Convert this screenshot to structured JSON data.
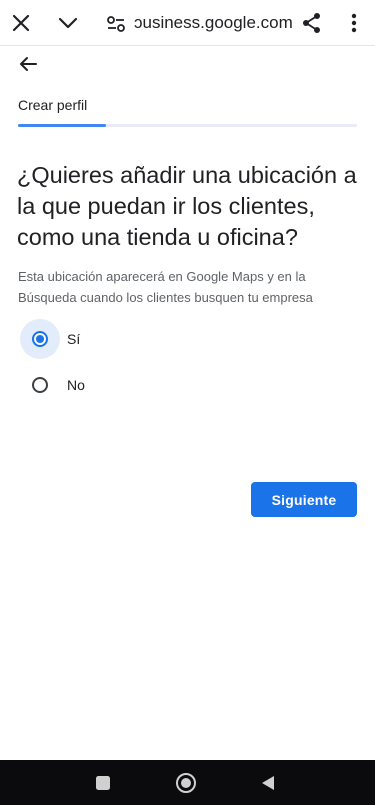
{
  "browser": {
    "url": "business.google.com",
    "url_display": "ɔusiness.google.com",
    "icons": {
      "close": "close-icon",
      "menu_down": "chevron-down-icon",
      "site_settings": "site-settings-icon",
      "share": "share-icon",
      "more": "more-vert-icon"
    }
  },
  "header": {
    "back_icon": "arrow-back-icon",
    "step_title": "Crear perfil",
    "progress_fraction": 0.26
  },
  "main": {
    "question": "¿Quieres añadir una ubicación a la que puedan ir los clientes, como una tienda u oficina?",
    "subtitle": "Esta ubicación aparecerá en Google Maps y en la Búsqueda cuando los clientes busquen tu empresa",
    "options": [
      {
        "label": "Sí",
        "selected": true
      },
      {
        "label": "No",
        "selected": false
      }
    ],
    "next_label": "Siguiente"
  },
  "colors": {
    "accent": "#1a73e8",
    "progress": "#4285f4",
    "selected_halo": "#e3ecfb",
    "nav_bar": "#0b0b0d"
  },
  "system_nav": {
    "icons": [
      "recents-square-icon",
      "home-circle-icon",
      "back-triangle-icon"
    ]
  }
}
